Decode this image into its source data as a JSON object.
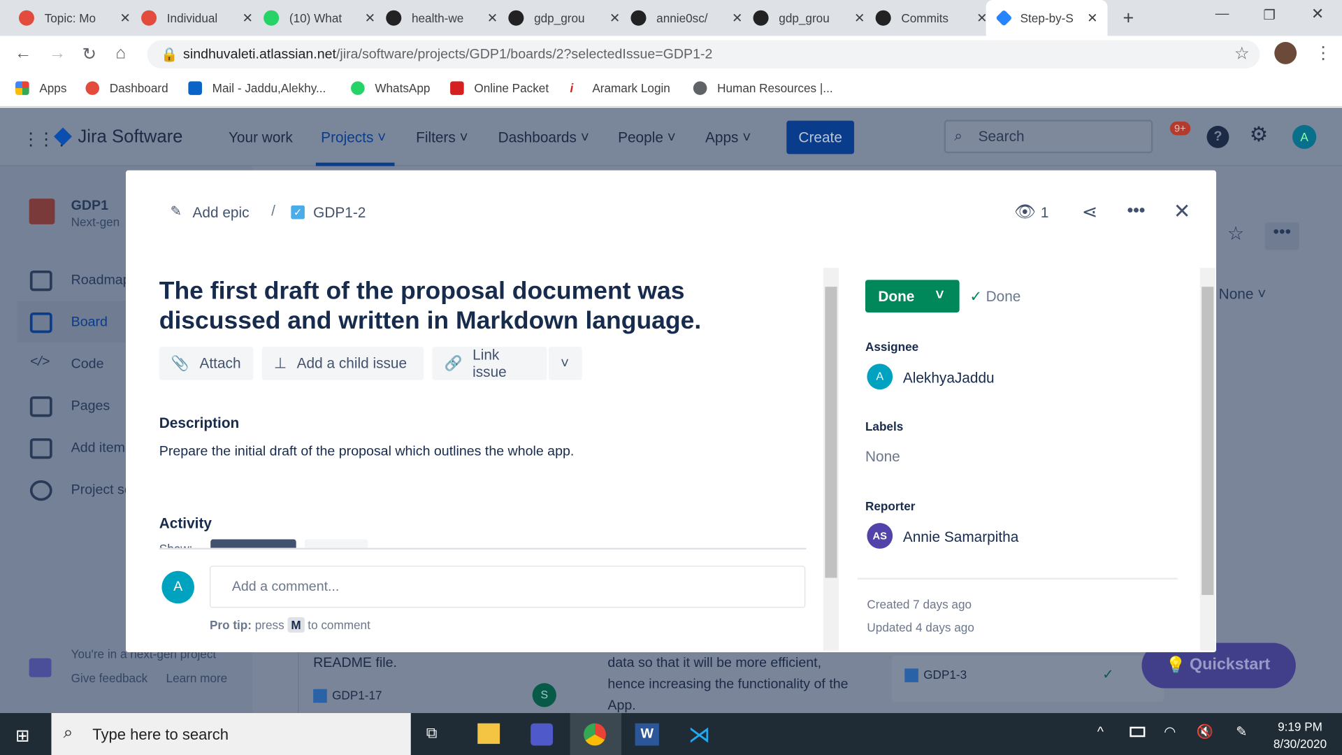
{
  "browser": {
    "tabs": [
      {
        "label": "Topic: Mo"
      },
      {
        "label": "Individual"
      },
      {
        "label": "(10) What"
      },
      {
        "label": "health-we"
      },
      {
        "label": "gdp_grou"
      },
      {
        "label": "annie0sc/"
      },
      {
        "label": "gdp_grou"
      },
      {
        "label": "Commits"
      },
      {
        "label": "Step-by-S"
      }
    ],
    "url_host": "sindhuvaleti.atlassian.net",
    "url_path": "/jira/software/projects/GDP1/boards/2?selectedIssue=GDP1-2",
    "bookmarks": [
      "Apps",
      "Dashboard",
      "Mail - Jaddu,Alekhy...",
      "WhatsApp",
      "Online Packet",
      "Aramark Login",
      "Human Resources |..."
    ]
  },
  "jira": {
    "logo": "Jira Software",
    "nav": [
      "Your work",
      "Projects",
      "Filters",
      "Dashboards",
      "People",
      "Apps"
    ],
    "create": "Create",
    "search_placeholder": "Search",
    "notif_badge": "9+",
    "avatar": "A",
    "project": {
      "name": "GDP1",
      "type": "Next-gen"
    },
    "sidebar": [
      "Roadmap",
      "Board",
      "Code",
      "Pages",
      "Add item",
      "Project settings"
    ],
    "sidebar_footer": {
      "text": "You're in a next-gen project",
      "feedback": "Give feedback",
      "learn": "Learn more"
    },
    "bg": {
      "none_filter": "None",
      "card1": "README file.",
      "card1_key": "GDP1-17",
      "card1_avatar": "S",
      "card2": "data so that it will be more efficient, hence increasing the functionality of the App.",
      "card3_key": "GDP1-3",
      "quickstart": "Quickstart"
    }
  },
  "issue": {
    "add_epic": "Add epic",
    "key": "GDP1-2",
    "watchers": "1",
    "title": "The first draft of the proposal document was discussed and written in Markdown language.",
    "actions": [
      "Attach",
      "Add a child issue",
      "Link issue"
    ],
    "description_label": "Description",
    "description": "Prepare the initial draft of the proposal which outlines the whole app.",
    "activity_label": "Activity",
    "show_label": "Show:",
    "comment_placeholder": "Add a comment...",
    "commenter_avatar": "A",
    "protip_bold": "Pro tip:",
    "protip_press": "press",
    "protip_key": "M",
    "protip_rest": "to comment",
    "status": "Done",
    "resolution": "Done",
    "assignee_label": "Assignee",
    "assignee": "AlekhyaJaddu",
    "assignee_avatar": "A",
    "labels_label": "Labels",
    "labels": "None",
    "reporter_label": "Reporter",
    "reporter": "Annie Samarpitha",
    "reporter_avatar": "AS",
    "created": "Created 7 days ago",
    "updated": "Updated 4 days ago"
  },
  "taskbar": {
    "search": "Type here to search",
    "time": "9:19 PM",
    "date": "8/30/2020"
  },
  "colors": {
    "jira_blue": "#0747a6",
    "done_green": "#00875a",
    "overlay": "#7a8599"
  }
}
